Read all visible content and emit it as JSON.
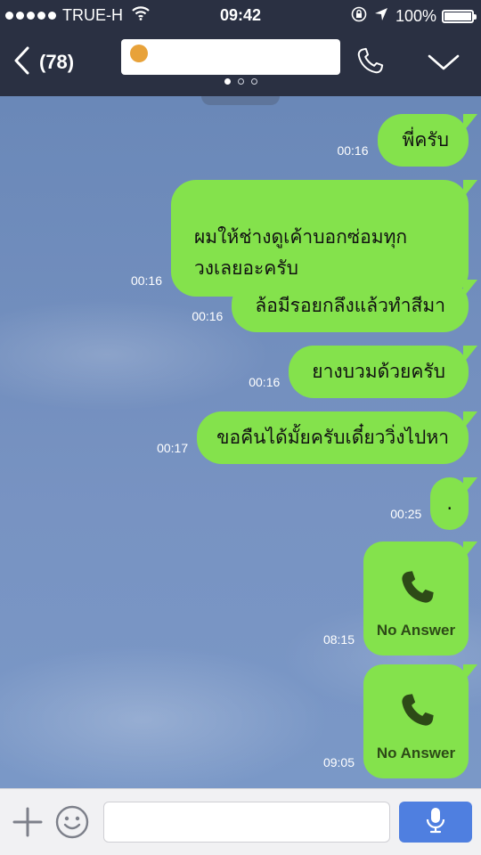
{
  "status_bar": {
    "carrier": "TRUE-H",
    "time": "09:42",
    "battery": "100%"
  },
  "header": {
    "back_count": "(78)"
  },
  "messages": [
    {
      "time": "00:16",
      "text": "พี่ครับ"
    },
    {
      "time": "00:16",
      "text": "ผมให้ช่างดูเค้าบอกซ่อมทุก\nวงเลยอะครับ"
    },
    {
      "time": "00:16",
      "text": "ล้อมีรอยกลึงแล้วทำสีมา"
    },
    {
      "time": "00:16",
      "text": "ยางบวมด้วยครับ"
    },
    {
      "time": "00:17",
      "text": "ขอคืนได้มั้ยครับเดี๋ยววิ่งไปหา"
    },
    {
      "time": "00:25",
      "text": "."
    }
  ],
  "calls": [
    {
      "time": "08:15",
      "label": "No Answer"
    },
    {
      "time": "09:05",
      "label": "No Answer"
    }
  ],
  "input": {
    "value": "",
    "placeholder": ""
  },
  "colors": {
    "header_bg": "#2a3042",
    "bubble_green": "#84e24c",
    "chat_bg": "#6e8fbf",
    "mic_blue": "#4f7fe0"
  }
}
